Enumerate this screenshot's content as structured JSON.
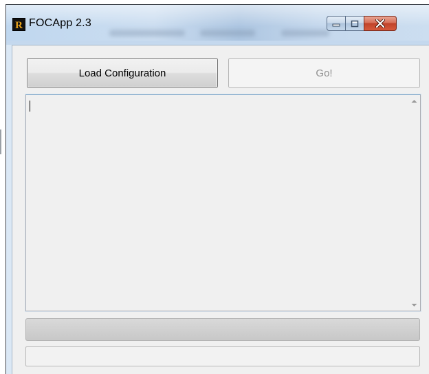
{
  "window": {
    "title": "FOCApp 2.3",
    "app_icon_letter": "R",
    "icon": "app-logo-icon"
  },
  "caption_buttons": {
    "minimize_icon": "minimize-icon",
    "maximize_icon": "maximize-icon",
    "close_icon": "close-icon"
  },
  "toolbar": {
    "load_label": "Load Configuration",
    "go_label": "Go!",
    "go_enabled": false
  },
  "output": {
    "text": "",
    "scroll_up_icon": "scroll-up-arrow-icon",
    "scroll_down_icon": "scroll-down-arrow-icon"
  },
  "progress": {
    "value": 0
  },
  "status": {
    "text": ""
  },
  "colors": {
    "title_bar": "#c4d8ee",
    "client_bg": "#f0f0f0",
    "close_button": "#c9472c",
    "disabled_text": "#8f8f8f"
  }
}
